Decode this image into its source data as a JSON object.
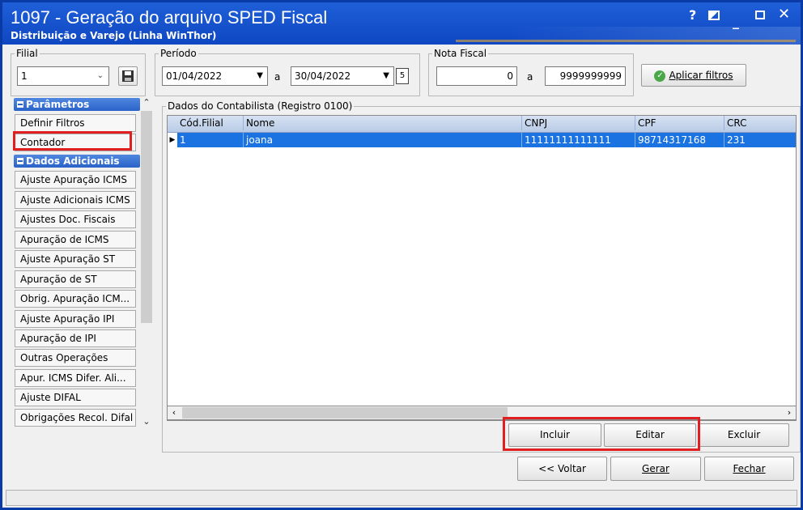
{
  "window": {
    "title": "1097 - Geração do arquivo SPED Fiscal",
    "subtitle": "Distribuição e Varejo (Linha WinThor)",
    "controls": {
      "help": "?",
      "minimize": "_",
      "close": "✕"
    }
  },
  "filial": {
    "legend": "Filial",
    "value": "1"
  },
  "periodo": {
    "legend": "Período",
    "start": "01/04/2022",
    "separator": "a",
    "end": "30/04/2022"
  },
  "nota_fiscal": {
    "legend": "Nota Fiscal",
    "start": "0",
    "separator": "a",
    "end": "9999999999"
  },
  "apply_button": {
    "label": "Aplicar filtros"
  },
  "nav": {
    "parametros_header": "Parâmetros",
    "parametros_items": [
      "Definir Filtros",
      "Contador"
    ],
    "adicionais_header": "Dados Adicionais",
    "adicionais_items": [
      "Ajuste Apuração ICMS",
      "Ajuste Adicionais ICMS",
      "Ajustes Doc. Fiscais",
      "Apuração de ICMS",
      "Ajuste Apuração ST",
      "Apuração de ST",
      "Obrig. Apuração ICM...",
      "Ajuste Apuração IPI",
      "Apuração de IPI",
      "Outras Operações",
      "Apur. ICMS Difer. Ali...",
      "Ajuste DIFAL",
      "Obrigações Recol. Difal"
    ]
  },
  "contabilista": {
    "legend": "Dados do Contabilista (Registro 0100)",
    "columns": [
      "Cód.Filial",
      "Nome",
      "CNPJ",
      "CPF",
      "CRC"
    ],
    "rows": [
      {
        "cod_filial": "1",
        "nome": "joana",
        "cnpj": "11111111111111",
        "cpf": "98714317168",
        "crc": "231"
      }
    ]
  },
  "grid_buttons": {
    "incluir": "Incluir",
    "editar": "Editar",
    "excluir": "Excluir"
  },
  "footer_buttons": {
    "voltar": "<< Voltar",
    "gerar": "Gerar",
    "fechar": "Fechar"
  },
  "colors": {
    "title_bar": "#1353cf",
    "selected_row": "#1a73e0",
    "highlight": "#e02020",
    "nav_header": "#2a63c8"
  }
}
